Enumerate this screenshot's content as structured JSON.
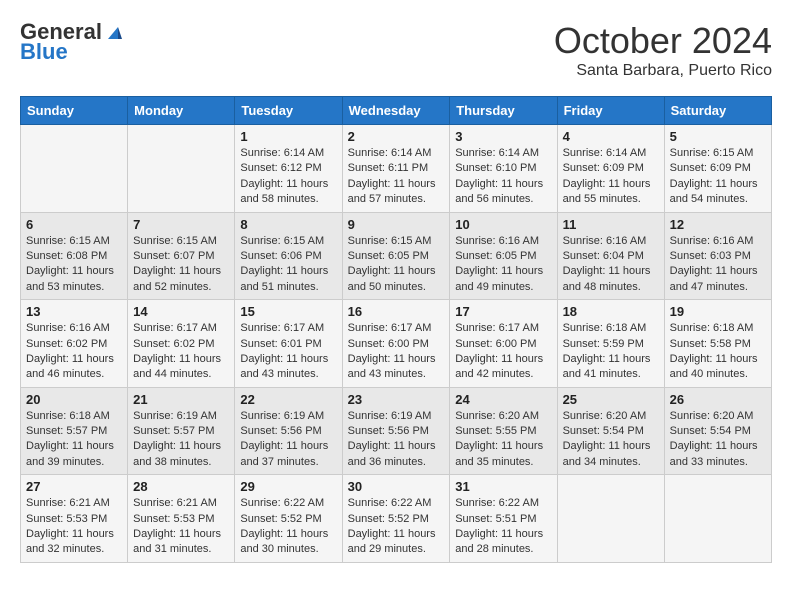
{
  "header": {
    "logo_general": "General",
    "logo_blue": "Blue",
    "month_title": "October 2024",
    "location": "Santa Barbara, Puerto Rico"
  },
  "weekdays": [
    "Sunday",
    "Monday",
    "Tuesday",
    "Wednesday",
    "Thursday",
    "Friday",
    "Saturday"
  ],
  "weeks": [
    [
      {
        "day": "",
        "sunrise": "",
        "sunset": "",
        "daylight": ""
      },
      {
        "day": "",
        "sunrise": "",
        "sunset": "",
        "daylight": ""
      },
      {
        "day": "1",
        "sunrise": "Sunrise: 6:14 AM",
        "sunset": "Sunset: 6:12 PM",
        "daylight": "Daylight: 11 hours and 58 minutes."
      },
      {
        "day": "2",
        "sunrise": "Sunrise: 6:14 AM",
        "sunset": "Sunset: 6:11 PM",
        "daylight": "Daylight: 11 hours and 57 minutes."
      },
      {
        "day": "3",
        "sunrise": "Sunrise: 6:14 AM",
        "sunset": "Sunset: 6:10 PM",
        "daylight": "Daylight: 11 hours and 56 minutes."
      },
      {
        "day": "4",
        "sunrise": "Sunrise: 6:14 AM",
        "sunset": "Sunset: 6:09 PM",
        "daylight": "Daylight: 11 hours and 55 minutes."
      },
      {
        "day": "5",
        "sunrise": "Sunrise: 6:15 AM",
        "sunset": "Sunset: 6:09 PM",
        "daylight": "Daylight: 11 hours and 54 minutes."
      }
    ],
    [
      {
        "day": "6",
        "sunrise": "Sunrise: 6:15 AM",
        "sunset": "Sunset: 6:08 PM",
        "daylight": "Daylight: 11 hours and 53 minutes."
      },
      {
        "day": "7",
        "sunrise": "Sunrise: 6:15 AM",
        "sunset": "Sunset: 6:07 PM",
        "daylight": "Daylight: 11 hours and 52 minutes."
      },
      {
        "day": "8",
        "sunrise": "Sunrise: 6:15 AM",
        "sunset": "Sunset: 6:06 PM",
        "daylight": "Daylight: 11 hours and 51 minutes."
      },
      {
        "day": "9",
        "sunrise": "Sunrise: 6:15 AM",
        "sunset": "Sunset: 6:05 PM",
        "daylight": "Daylight: 11 hours and 50 minutes."
      },
      {
        "day": "10",
        "sunrise": "Sunrise: 6:16 AM",
        "sunset": "Sunset: 6:05 PM",
        "daylight": "Daylight: 11 hours and 49 minutes."
      },
      {
        "day": "11",
        "sunrise": "Sunrise: 6:16 AM",
        "sunset": "Sunset: 6:04 PM",
        "daylight": "Daylight: 11 hours and 48 minutes."
      },
      {
        "day": "12",
        "sunrise": "Sunrise: 6:16 AM",
        "sunset": "Sunset: 6:03 PM",
        "daylight": "Daylight: 11 hours and 47 minutes."
      }
    ],
    [
      {
        "day": "13",
        "sunrise": "Sunrise: 6:16 AM",
        "sunset": "Sunset: 6:02 PM",
        "daylight": "Daylight: 11 hours and 46 minutes."
      },
      {
        "day": "14",
        "sunrise": "Sunrise: 6:17 AM",
        "sunset": "Sunset: 6:02 PM",
        "daylight": "Daylight: 11 hours and 44 minutes."
      },
      {
        "day": "15",
        "sunrise": "Sunrise: 6:17 AM",
        "sunset": "Sunset: 6:01 PM",
        "daylight": "Daylight: 11 hours and 43 minutes."
      },
      {
        "day": "16",
        "sunrise": "Sunrise: 6:17 AM",
        "sunset": "Sunset: 6:00 PM",
        "daylight": "Daylight: 11 hours and 43 minutes."
      },
      {
        "day": "17",
        "sunrise": "Sunrise: 6:17 AM",
        "sunset": "Sunset: 6:00 PM",
        "daylight": "Daylight: 11 hours and 42 minutes."
      },
      {
        "day": "18",
        "sunrise": "Sunrise: 6:18 AM",
        "sunset": "Sunset: 5:59 PM",
        "daylight": "Daylight: 11 hours and 41 minutes."
      },
      {
        "day": "19",
        "sunrise": "Sunrise: 6:18 AM",
        "sunset": "Sunset: 5:58 PM",
        "daylight": "Daylight: 11 hours and 40 minutes."
      }
    ],
    [
      {
        "day": "20",
        "sunrise": "Sunrise: 6:18 AM",
        "sunset": "Sunset: 5:57 PM",
        "daylight": "Daylight: 11 hours and 39 minutes."
      },
      {
        "day": "21",
        "sunrise": "Sunrise: 6:19 AM",
        "sunset": "Sunset: 5:57 PM",
        "daylight": "Daylight: 11 hours and 38 minutes."
      },
      {
        "day": "22",
        "sunrise": "Sunrise: 6:19 AM",
        "sunset": "Sunset: 5:56 PM",
        "daylight": "Daylight: 11 hours and 37 minutes."
      },
      {
        "day": "23",
        "sunrise": "Sunrise: 6:19 AM",
        "sunset": "Sunset: 5:56 PM",
        "daylight": "Daylight: 11 hours and 36 minutes."
      },
      {
        "day": "24",
        "sunrise": "Sunrise: 6:20 AM",
        "sunset": "Sunset: 5:55 PM",
        "daylight": "Daylight: 11 hours and 35 minutes."
      },
      {
        "day": "25",
        "sunrise": "Sunrise: 6:20 AM",
        "sunset": "Sunset: 5:54 PM",
        "daylight": "Daylight: 11 hours and 34 minutes."
      },
      {
        "day": "26",
        "sunrise": "Sunrise: 6:20 AM",
        "sunset": "Sunset: 5:54 PM",
        "daylight": "Daylight: 11 hours and 33 minutes."
      }
    ],
    [
      {
        "day": "27",
        "sunrise": "Sunrise: 6:21 AM",
        "sunset": "Sunset: 5:53 PM",
        "daylight": "Daylight: 11 hours and 32 minutes."
      },
      {
        "day": "28",
        "sunrise": "Sunrise: 6:21 AM",
        "sunset": "Sunset: 5:53 PM",
        "daylight": "Daylight: 11 hours and 31 minutes."
      },
      {
        "day": "29",
        "sunrise": "Sunrise: 6:22 AM",
        "sunset": "Sunset: 5:52 PM",
        "daylight": "Daylight: 11 hours and 30 minutes."
      },
      {
        "day": "30",
        "sunrise": "Sunrise: 6:22 AM",
        "sunset": "Sunset: 5:52 PM",
        "daylight": "Daylight: 11 hours and 29 minutes."
      },
      {
        "day": "31",
        "sunrise": "Sunrise: 6:22 AM",
        "sunset": "Sunset: 5:51 PM",
        "daylight": "Daylight: 11 hours and 28 minutes."
      },
      {
        "day": "",
        "sunrise": "",
        "sunset": "",
        "daylight": ""
      },
      {
        "day": "",
        "sunrise": "",
        "sunset": "",
        "daylight": ""
      }
    ]
  ]
}
